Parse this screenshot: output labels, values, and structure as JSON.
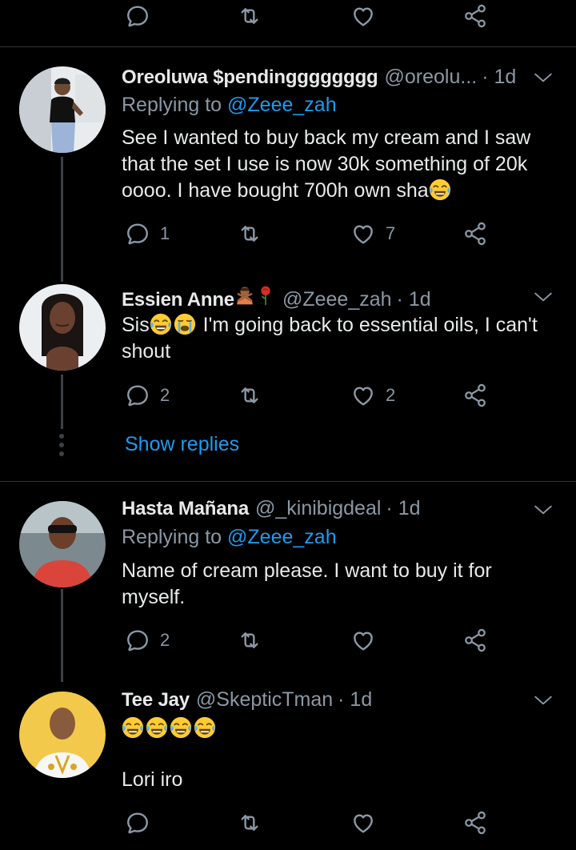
{
  "colors": {
    "background": "#000000",
    "accent": "#1d9bf0",
    "muted": "#8b98a5",
    "text": "#e7e9ea",
    "divider": "#2f3336"
  },
  "top_actions": {
    "reply_icon": "reply-icon",
    "retweet_icon": "retweet-icon",
    "like_icon": "like-icon",
    "share_icon": "share-icon"
  },
  "tweets": [
    {
      "name": "Oreoluwa $pendingggggggg",
      "handle": "@oreolu...",
      "time": "· 1d",
      "replying_prefix": "Replying to",
      "replying_to": "@Zeee_zah",
      "body_lines": [
        "See I wanted to buy back my cream and I saw",
        "that the set I use is now 30k something of 20k",
        "oooo. I have bought 700h own sha"
      ],
      "emoji": "face-with-tears-of-joy",
      "replies": "1",
      "likes": "7"
    },
    {
      "name": "Essien Anne",
      "name_emojis": [
        "person-gesturing-no",
        "rose"
      ],
      "handle": "@Zeee_zah",
      "time": "· 1d",
      "body_prefix": "Sis",
      "body_emojis": [
        "face-with-tears-of-joy",
        "loudly-crying-face"
      ],
      "body_rest": " I'm going back to essential oils, I can't",
      "body_line2": "shout",
      "replies": "2",
      "likes": "2"
    },
    {
      "name": "Hasta Mañana",
      "handle": "@_kinibigdeal",
      "time": "· 1d",
      "replying_prefix": "Replying to",
      "replying_to": "@Zeee_zah",
      "body_lines": [
        "Name of cream please. I want to buy it for",
        "myself."
      ],
      "replies": "2",
      "likes": ""
    },
    {
      "name": "Tee Jay",
      "handle": "@SkepticTman",
      "time": "· 1d",
      "emoji_row": [
        "face-with-tears-of-joy",
        "face-with-tears-of-joy",
        "face-with-tears-of-joy",
        "face-with-tears-of-joy"
      ],
      "body": "Lori iro",
      "replies": "",
      "likes": ""
    }
  ],
  "show_replies": "Show replies"
}
